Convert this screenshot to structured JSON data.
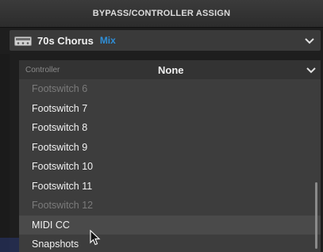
{
  "header": {
    "title": "BYPASS/CONTROLLER ASSIGN"
  },
  "effect": {
    "name": "70s Chorus",
    "parameter": "Mix",
    "icon": "pedal-icon"
  },
  "controller": {
    "label": "Controller",
    "value": "None"
  },
  "options": [
    {
      "label": "Footswitch 6",
      "enabled": false
    },
    {
      "label": "Footswitch 7",
      "enabled": true
    },
    {
      "label": "Footswitch 8",
      "enabled": true
    },
    {
      "label": "Footswitch 9",
      "enabled": true
    },
    {
      "label": "Footswitch 10",
      "enabled": true
    },
    {
      "label": "Footswitch 11",
      "enabled": true
    },
    {
      "label": "Footswitch 12",
      "enabled": false
    },
    {
      "label": "MIDI CC",
      "enabled": true,
      "hovered": true
    },
    {
      "label": "Snapshots",
      "enabled": true
    }
  ],
  "colors": {
    "accent": "#2f8fd8"
  }
}
